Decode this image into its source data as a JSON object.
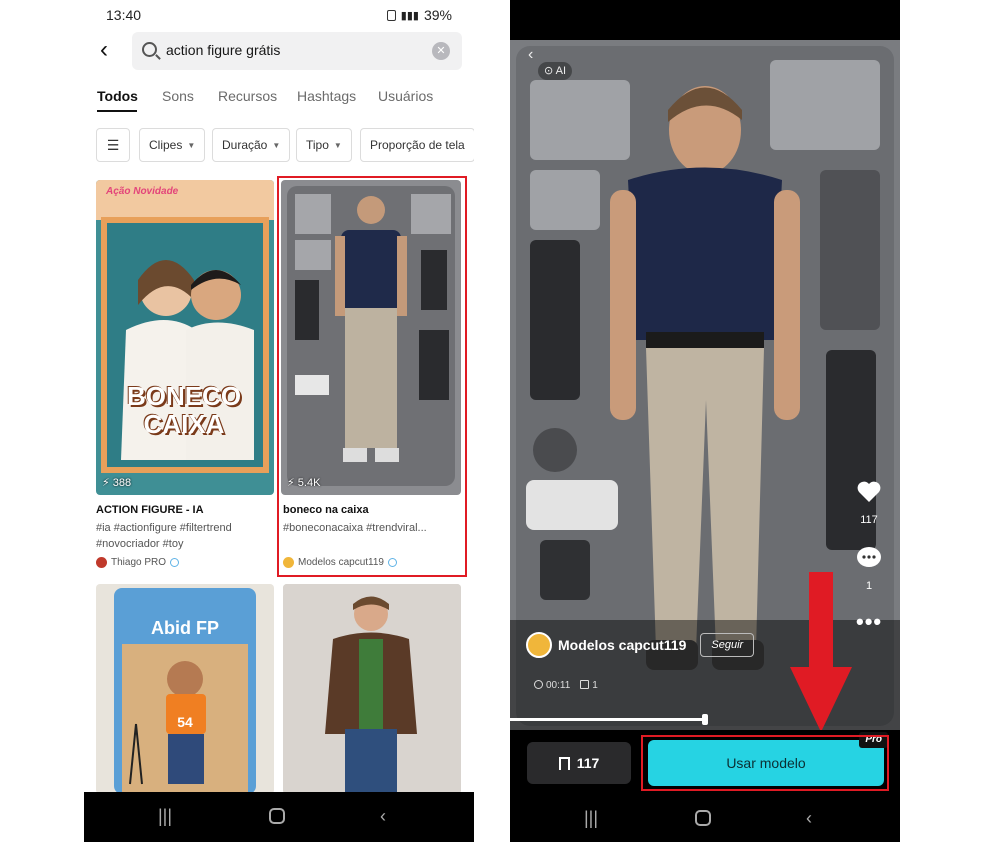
{
  "left": {
    "status": {
      "time": "13:40",
      "battery": "39%"
    },
    "search": {
      "query": "action figure grátis"
    },
    "tabs": [
      "Todos",
      "Sons",
      "Recursos",
      "Hashtags",
      "Usuários"
    ],
    "filters": [
      "Clipes",
      "Duração",
      "Tipo",
      "Proporção de tela"
    ],
    "cards": [
      {
        "overlay_text": "BONECO CAIXA",
        "banner_text": "Ação Novidade",
        "views": "388",
        "title": "ACTION FIGURE - IA",
        "tags": "#ia #actionfigure #filtertrend #novocriador #toy",
        "author": "Thiago PRO"
      },
      {
        "views": "5.4K",
        "title": "boneco na caixa",
        "tags": "#boneconacaixa #trendviral...",
        "author": "Modelos capcut119"
      },
      {
        "overlay_text": "Abid FP",
        "shirt_number": "54"
      },
      {}
    ]
  },
  "right": {
    "ai_badge": "AI",
    "creator": {
      "name": "Modelos capcut119",
      "follow_label": "Seguir"
    },
    "meta": {
      "duration": "00:11",
      "clips": "1"
    },
    "side_actions": {
      "likes": "117",
      "comments": "1"
    },
    "save_count": "117",
    "use_label": "Usar modelo",
    "pro_badge": "Pro"
  },
  "colors": {
    "accent_cyan": "#26d3e3",
    "highlight_red": "#e01b24"
  }
}
